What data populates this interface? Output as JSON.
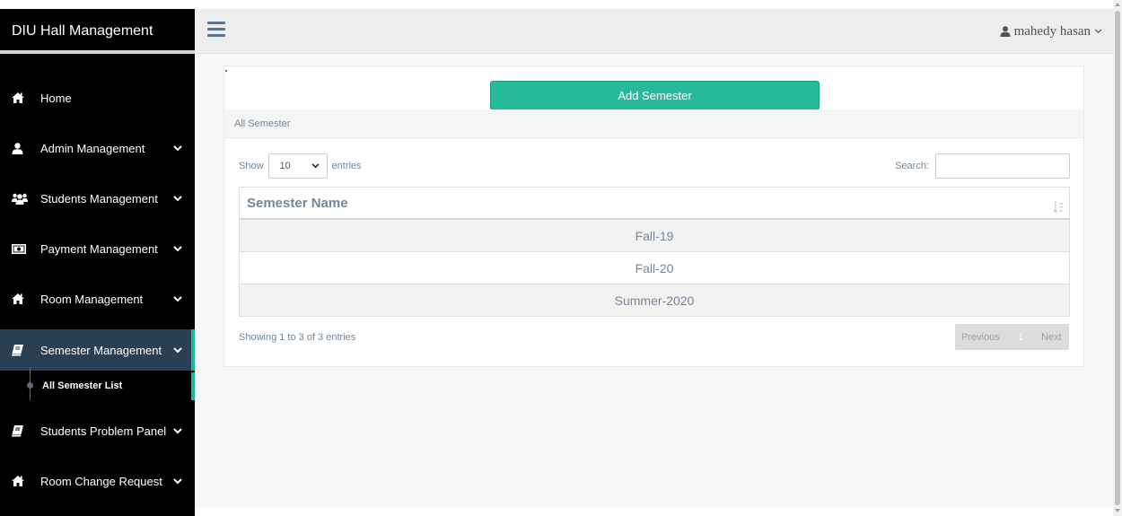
{
  "app": {
    "title": "DIU Hall Management"
  },
  "sidebar": {
    "items": [
      {
        "label": "Home",
        "icon": "home-icon",
        "has_chevron": false
      },
      {
        "label": "Admin Management",
        "icon": "user-icon",
        "has_chevron": true
      },
      {
        "label": "Students Management",
        "icon": "users-icon",
        "has_chevron": true
      },
      {
        "label": "Payment Management",
        "icon": "money-icon",
        "has_chevron": true
      },
      {
        "label": "Room Management",
        "icon": "home-icon",
        "has_chevron": true
      },
      {
        "label": "Semester Management",
        "icon": "book-icon",
        "has_chevron": true,
        "active": true
      },
      {
        "label": "Students Problem Panel",
        "icon": "book-icon",
        "has_chevron": true
      },
      {
        "label": "Room Change Request",
        "icon": "home-icon",
        "has_chevron": true
      }
    ],
    "submenu": {
      "label": "All Semester List"
    }
  },
  "topnav": {
    "user_name": "mahedy hasan"
  },
  "panel": {
    "add_button": "Add Semester",
    "heading": "All Semester"
  },
  "datatable": {
    "show_label": "Show",
    "page_length": "10",
    "entries_label": "entries",
    "search_label": "Search:",
    "search_value": "",
    "column_header": "Semester Name",
    "rows": [
      "Fall-19",
      "Fall-20",
      "Summer-2020"
    ],
    "info": "Showing 1 to 3 of 3 entries",
    "pager": {
      "previous": "Previous",
      "page": "1",
      "next": "Next"
    }
  },
  "colors": {
    "sidebar_bg": "#000000",
    "active_bg": "#2a3f54",
    "accent": "#1abb9c",
    "button_bg": "#26b99a",
    "text_muted": "#73879c"
  }
}
